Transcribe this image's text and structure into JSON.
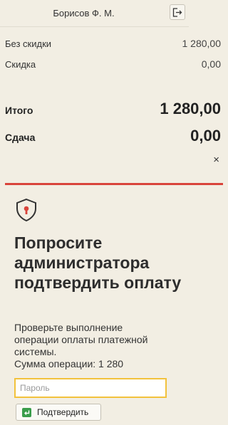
{
  "header": {
    "user": "Борисов Ф. М.",
    "logout_icon": "logout-icon"
  },
  "totals": {
    "no_discount_label": "Без скидки",
    "no_discount_value": "1 280,00",
    "discount_label": "Скидка",
    "discount_value": "0,00",
    "total_label": "Итого",
    "total_value": "1 280,00",
    "change_label": "Сдача",
    "change_value": "0,00",
    "close": "×"
  },
  "confirm_panel": {
    "icon": "shield-lock-icon",
    "title": "Попросите администратора подтвердить оплату",
    "desc_line1": "Проверьте выполнение",
    "desc_line2": "операции оплаты платежной",
    "desc_line3": "системы.",
    "desc_line4": "Сумма операции: 1 280",
    "password_placeholder": "Пароль",
    "password_value": "",
    "confirm_label": "Подтвердить"
  },
  "colors": {
    "accent_red": "#d9443b",
    "focus_yellow": "#f2c23c",
    "ok_green": "#3a9d4b"
  }
}
